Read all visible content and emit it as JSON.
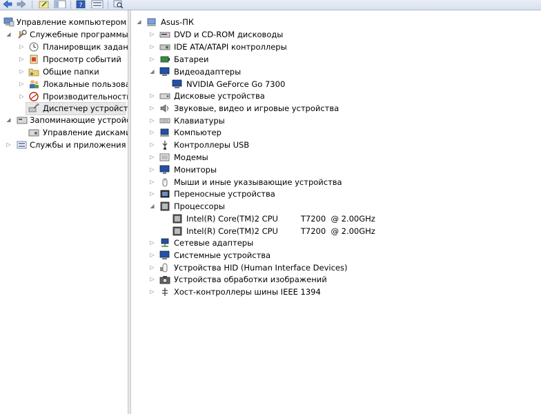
{
  "left_tree": {
    "root": "Управление компьютером (л",
    "service_tools": "Служебные программы",
    "task_scheduler": "Планировщик заданий",
    "event_viewer": "Просмотр событий",
    "shared_folders": "Общие папки",
    "local_users": "Локальные пользовате",
    "performance": "Производительность",
    "device_manager": "Диспетчер устройств",
    "storage": "Запоминающие устройст",
    "disk_management": "Управление дисками",
    "services_apps": "Службы и приложения"
  },
  "device_tree": {
    "computer": "Asus-ПК",
    "categories": [
      {
        "label": "DVD и CD-ROM дисководы",
        "icon": "dvd-drive-icon"
      },
      {
        "label": "IDE ATA/ATAPI контроллеры",
        "icon": "ide-controller-icon"
      },
      {
        "label": "Батареи",
        "icon": "battery-icon"
      },
      {
        "label": "Видеоадаптеры",
        "icon": "display-adapter-icon",
        "children": [
          "NVIDIA GeForce Go 7300"
        ]
      },
      {
        "label": "Дисковые устройства",
        "icon": "disk-drive-icon"
      },
      {
        "label": "Звуковые, видео и игровые устройства",
        "icon": "sound-device-icon"
      },
      {
        "label": "Клавиатуры",
        "icon": "keyboard-icon"
      },
      {
        "label": "Компьютер",
        "icon": "computer-icon"
      },
      {
        "label": "Контроллеры USB",
        "icon": "usb-controller-icon"
      },
      {
        "label": "Модемы",
        "icon": "modem-icon"
      },
      {
        "label": "Мониторы",
        "icon": "monitor-icon"
      },
      {
        "label": "Мыши и иные указывающие устройства",
        "icon": "mouse-icon"
      },
      {
        "label": "Переносные устройства",
        "icon": "portable-device-icon"
      },
      {
        "label": "Процессоры",
        "icon": "processor-icon",
        "children": [
          "Intel(R) Core(TM)2 CPU         T7200  @ 2.00GHz",
          "Intel(R) Core(TM)2 CPU         T7200  @ 2.00GHz"
        ]
      },
      {
        "label": "Сетевые адаптеры",
        "icon": "network-adapter-icon"
      },
      {
        "label": "Системные устройства",
        "icon": "system-device-icon"
      },
      {
        "label": "Устройства HID (Human Interface Devices)",
        "icon": "hid-icon"
      },
      {
        "label": "Устройства обработки изображений",
        "icon": "imaging-device-icon"
      },
      {
        "label": "Хост-контроллеры шины IEEE 1394",
        "icon": "ieee1394-icon"
      }
    ]
  },
  "colors": {
    "toolbar_bg": "#dfe6f1",
    "selection_bg": "#e8e8e8",
    "expander": "#7a7a7a"
  }
}
